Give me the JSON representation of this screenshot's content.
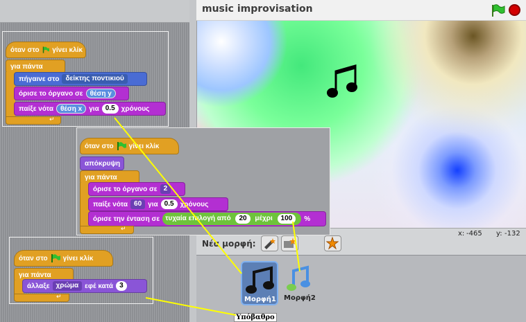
{
  "window": {
    "title": "music improvisation"
  },
  "stage": {
    "coords": {
      "x_label": "x:",
      "x_value": "-465",
      "y_label": "y:",
      "y_value": "-132"
    }
  },
  "sprites": {
    "new_sprite_label": "Νέα μορφή:",
    "items": [
      {
        "name": "Μορφή1"
      },
      {
        "name": "Μορφή2"
      }
    ],
    "stage_label": "Υπόβαθρο"
  },
  "script1": {
    "hat": {
      "pre": "όταν στο",
      "post": "γίνει κλίκ"
    },
    "forever": "για πάντα",
    "goto": {
      "label": "πήγαινε στο",
      "value": "δείκτης ποντικιού"
    },
    "instrument": {
      "label": "όρισε το όργανο σε",
      "value": "θέση y"
    },
    "note": {
      "label": "παίξε νότα",
      "value": "θέση x",
      "mid": "για",
      "beats": "0.5",
      "unit": "χρόνους"
    }
  },
  "script2": {
    "hat": {
      "pre": "όταν στο",
      "post": "γίνει κλίκ"
    },
    "hide": "απόκρυψη",
    "forever": "για πάντα",
    "instrument": {
      "label": "όρισε το όργανο σε",
      "value": "2"
    },
    "note": {
      "label": "παίξε νότα",
      "value": "60",
      "mid": "για",
      "beats": "0.5",
      "unit": "χρόνους"
    },
    "volume": {
      "label": "όρισε την ένταση σε",
      "random": "τυχαία επιλογή από",
      "from": "20",
      "to_label": "μέχρι",
      "to": "100",
      "unit": "%"
    }
  },
  "script3": {
    "hat": {
      "pre": "όταν στο",
      "post": "γίνει κλίκ"
    },
    "forever": "για πάντα",
    "effect": {
      "label": "άλλαξε",
      "effect": "χρώμα",
      "mid": "εφέ κατά",
      "value": "3"
    }
  },
  "colors": {
    "event": "#e1a023",
    "motion": "#4a6cd4",
    "sound": "#b32fd2",
    "looks": "#8a55d7",
    "operator": "#6ec33b",
    "callout": "#ffff00"
  }
}
